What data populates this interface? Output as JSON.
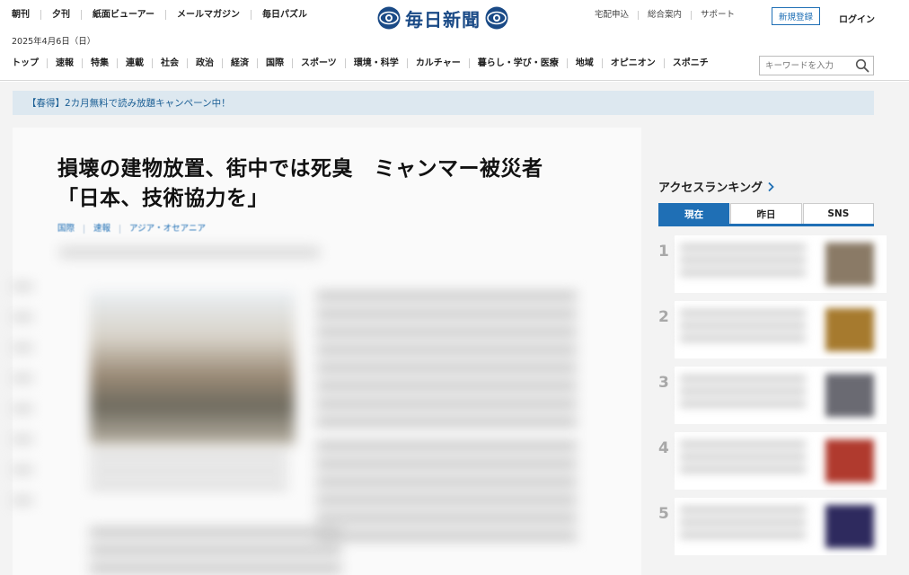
{
  "header": {
    "top_links": [
      "朝刊",
      "夕刊",
      "紙面ビューアー",
      "メールマガジン",
      "毎日パズル"
    ],
    "date": "2025年4月6日（日）",
    "logo_text": "毎日新聞",
    "utility_links": [
      "宅配申込",
      "総合案内",
      "サポート"
    ],
    "register_label": "新規登録",
    "login_label": "ログイン",
    "nav": [
      "トップ",
      "速報",
      "特集",
      "連載",
      "社会",
      "政治",
      "経済",
      "国際",
      "スポーツ",
      "環境・科学",
      "カルチャー",
      "暮らし・学び・医療",
      "地域",
      "オピニオン",
      "スポニチ"
    ],
    "search_placeholder": "キーワードを入力",
    "search_icon": "search-icon"
  },
  "campaign": {
    "text": "【春得】2カ月無料で読み放題キャンペーン中！"
  },
  "article": {
    "headline_line1": "損壊の建物放置、街中では死臭　ミャンマー被災者",
    "headline_line2": "「日本、技術協力を」",
    "tags": [
      "国際",
      "速報",
      "アジア・オセアニア"
    ]
  },
  "ranking": {
    "title": "アクセスランキング",
    "tabs": [
      "現在",
      "昨日",
      "SNS"
    ],
    "active_tab": "現在",
    "items": [
      {
        "rank": "1",
        "thumb_color": "#8a7a66"
      },
      {
        "rank": "2",
        "thumb_color": "#a67a2e"
      },
      {
        "rank": "3",
        "thumb_color": "#6a6a72"
      },
      {
        "rank": "4",
        "thumb_color": "#b03a2e"
      },
      {
        "rank": "5",
        "thumb_color": "#2e2a5e"
      }
    ]
  },
  "colors": {
    "brand_blue": "#1f6fb5",
    "logo_blue": "#1a4a86",
    "campaign_bg": "#dde8f0"
  }
}
